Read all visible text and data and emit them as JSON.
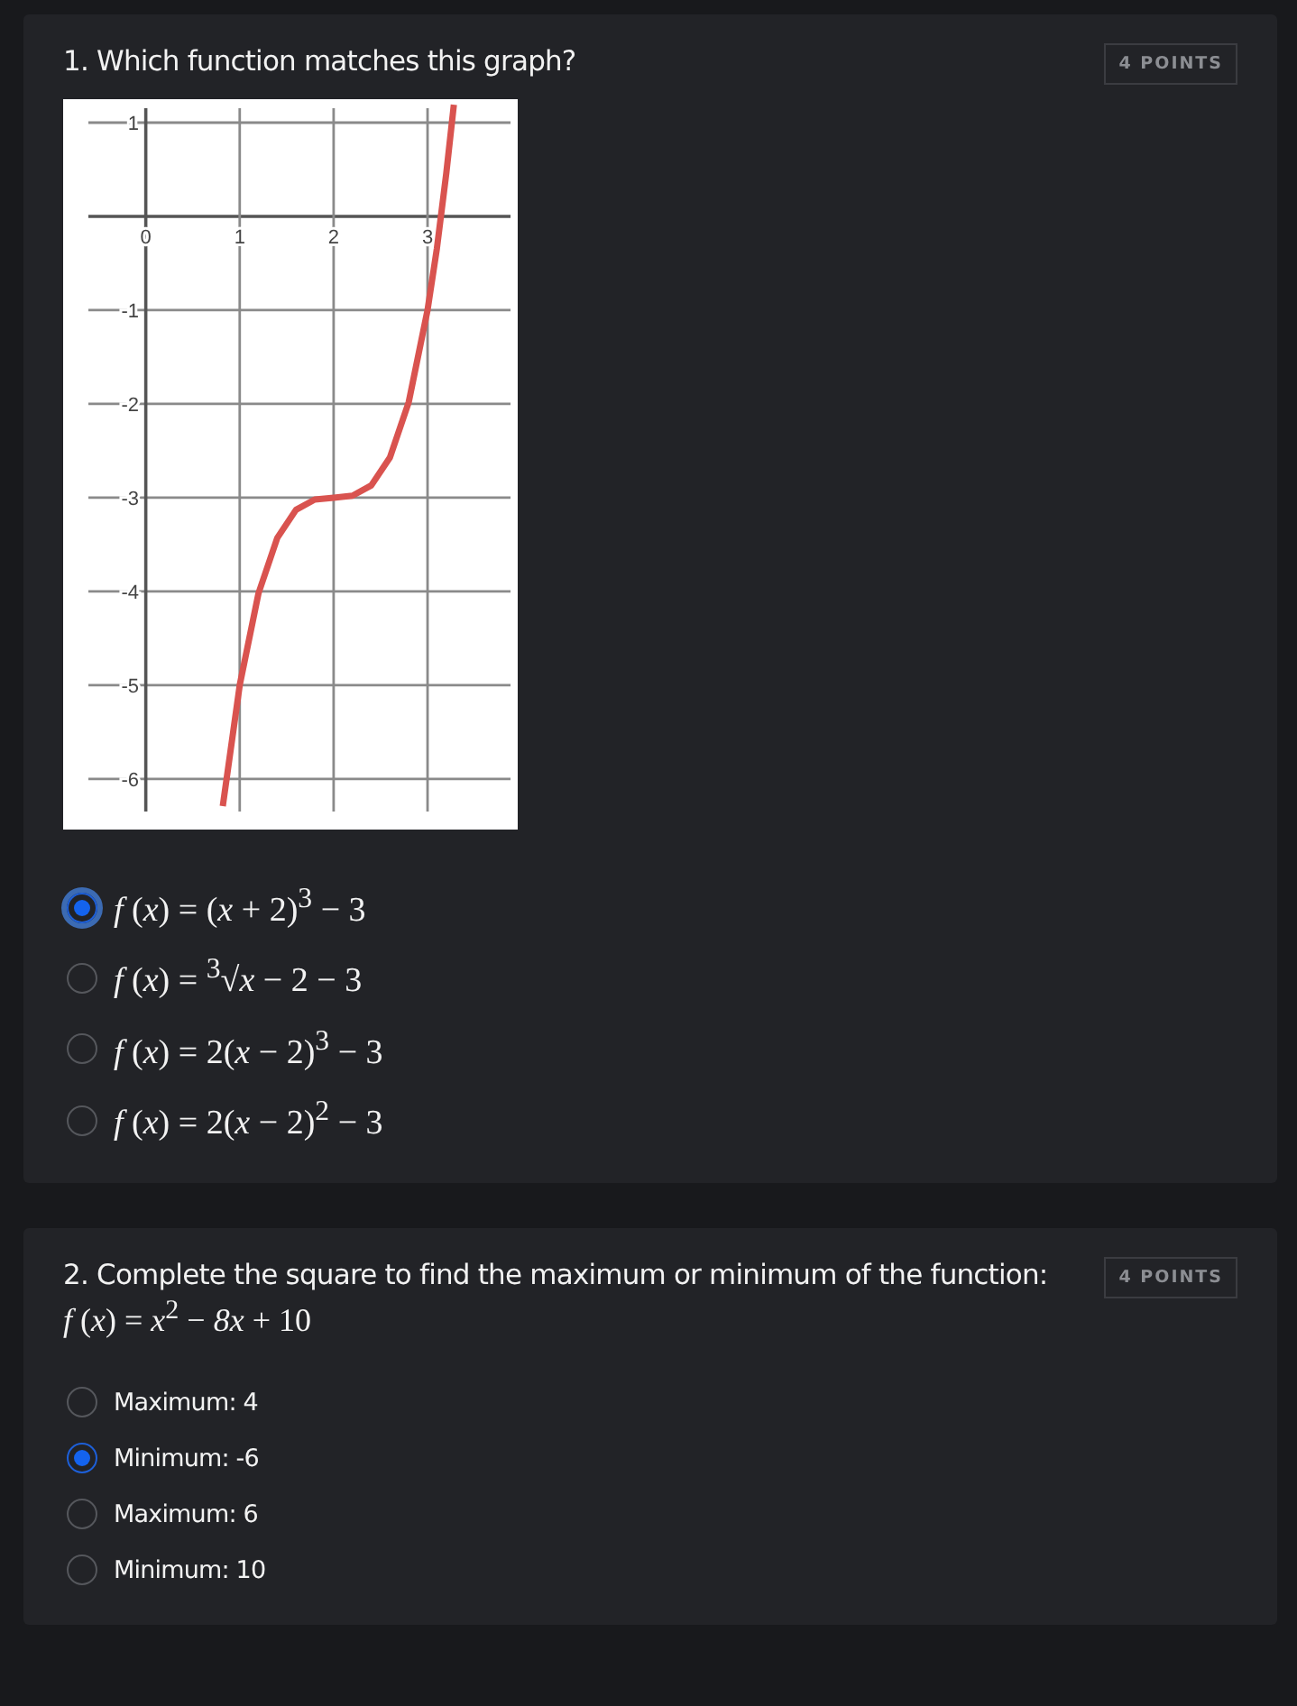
{
  "questions": [
    {
      "title": "1. Which function matches this graph?",
      "points": "4 POINTS",
      "chart_data": {
        "type": "line",
        "x": [
          0.82,
          1.0,
          1.2,
          1.4,
          1.6,
          1.8,
          2.0,
          2.2,
          2.4,
          2.6,
          2.8,
          3.0,
          3.1,
          3.2,
          3.28
        ],
        "xlim": [
          -0.88,
          3.96
        ],
        "ylim": [
          -6.54,
          1.25
        ],
        "xticks": [
          0,
          1,
          2,
          3
        ],
        "yticks": [
          1,
          -1,
          -2,
          -3,
          -4,
          -5,
          -6
        ],
        "series": [
          {
            "color": "#d9534f",
            "values": [
              -6.29,
              -5,
              -4.02,
              -3.43,
              -3.13,
              -3.02,
              -3,
              -2.98,
              -2.87,
              -2.57,
              -1.98,
              -1,
              -0.34,
              0.46,
              1.19
            ]
          }
        ],
        "grid": true
      },
      "options": [
        {
          "kind": "math",
          "text": "*f* (*x*) = (*x* + 2)$^{3}$ − 3",
          "selected": true,
          "focused": true
        },
        {
          "kind": "math",
          "text": "*f* (*x*) = $^{3}$√*x* − 2 − 3",
          "selected": false,
          "focused": false
        },
        {
          "kind": "math",
          "text": "*f* (*x*) = 2(*x* − 2)$^{3}$ − 3",
          "selected": false,
          "focused": false
        },
        {
          "kind": "math",
          "text": "*f* (*x*) = 2(*x* − 2)$^{2}$ − 3",
          "selected": false,
          "focused": false
        }
      ]
    },
    {
      "title": "2. Complete the square to find the maximum or minimum of the function:",
      "formula": "*f* (*x*) = *x*$^{2}$ − *8x* + 10",
      "points": "4 POINTS",
      "options": [
        {
          "kind": "text",
          "text": "Maximum: 4",
          "selected": false,
          "focused": false
        },
        {
          "kind": "text",
          "text": "Minimum: -6",
          "selected": true,
          "focused": false
        },
        {
          "kind": "text",
          "text": "Maximum: 6",
          "selected": false,
          "focused": false
        },
        {
          "kind": "text",
          "text": "Minimum: 10",
          "selected": false,
          "focused": false
        }
      ]
    }
  ]
}
